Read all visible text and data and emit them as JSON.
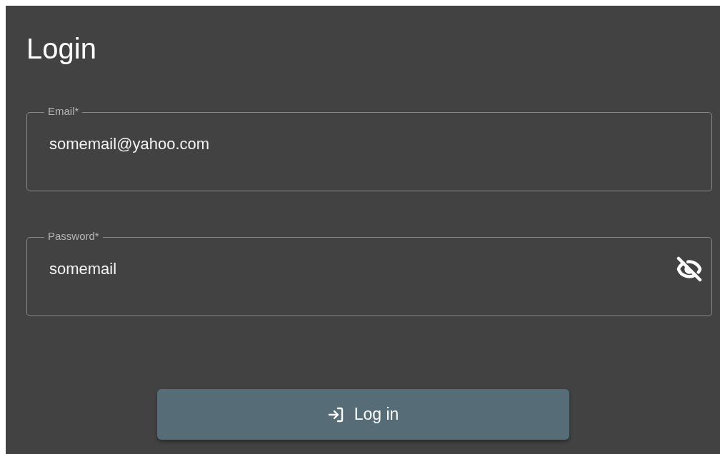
{
  "title": "Login",
  "fields": [
    {
      "kind": "text",
      "label": "Email*",
      "value": "somemail@yahoo.com"
    },
    {
      "kind": "password",
      "label": "Password*",
      "value": "somemail",
      "password_visible": true
    }
  ],
  "submit": {
    "label": "Log in"
  }
}
